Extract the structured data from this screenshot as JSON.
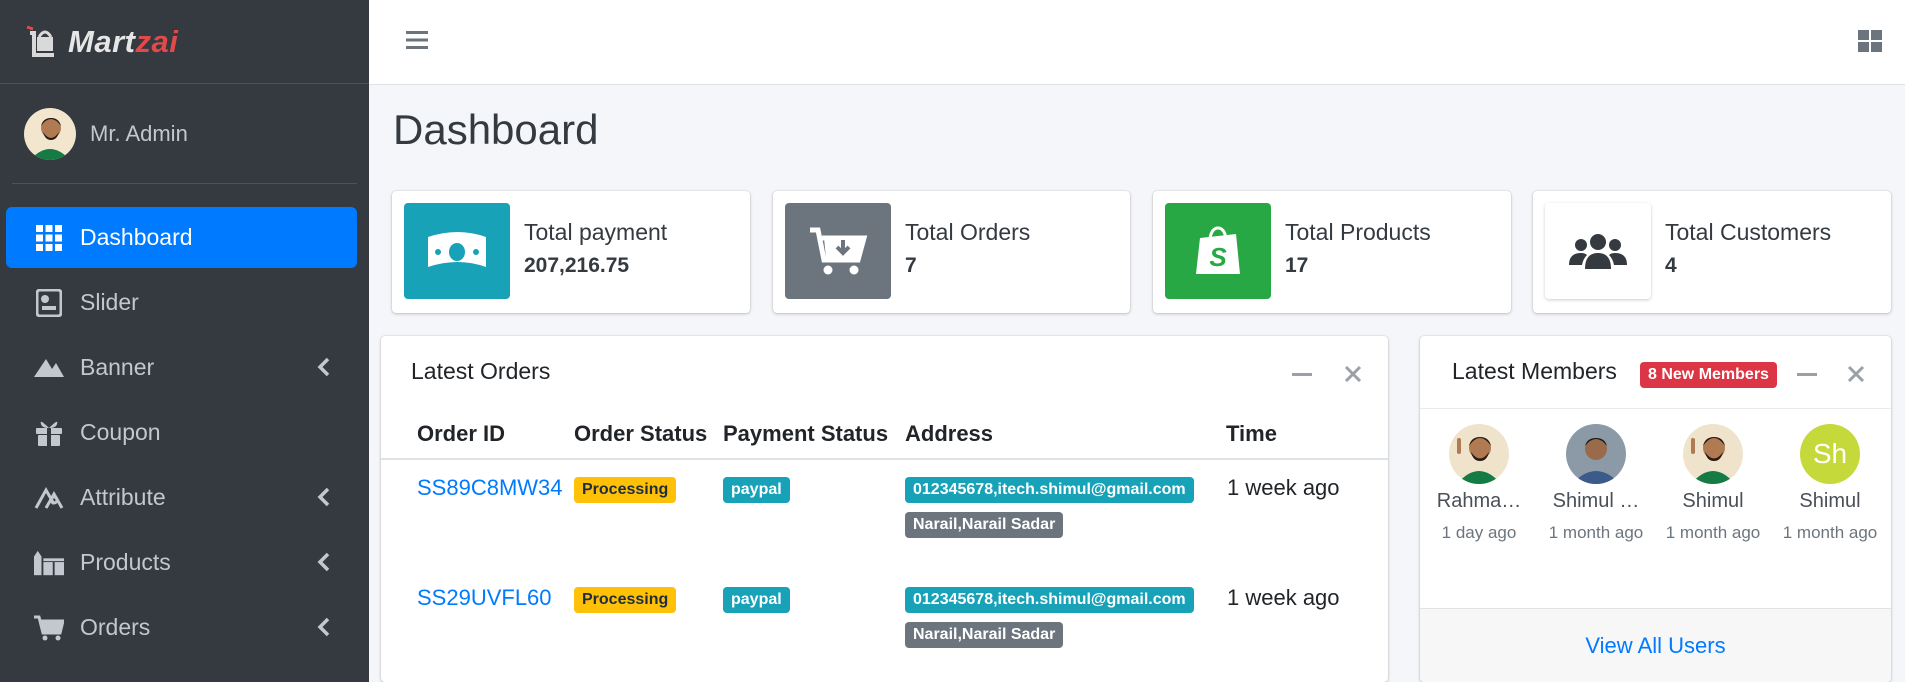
{
  "brand": {
    "name_main": "Mart",
    "name_accent": "zai"
  },
  "user": {
    "name": "Mr. Admin"
  },
  "sidebar": {
    "items": [
      {
        "label": "Dashboard",
        "icon": "th-grid-icon",
        "active": true
      },
      {
        "label": "Slider",
        "icon": "slider-icon"
      },
      {
        "label": "Banner",
        "icon": "banner-icon",
        "has_submenu": true
      },
      {
        "label": "Coupon",
        "icon": "gift-icon"
      },
      {
        "label": "Attribute",
        "icon": "attribute-icon",
        "has_submenu": true
      },
      {
        "label": "Products",
        "icon": "warehouse-icon",
        "has_submenu": true
      },
      {
        "label": "Orders",
        "icon": "cart-icon",
        "has_submenu": true
      }
    ]
  },
  "page": {
    "title": "Dashboard"
  },
  "info_boxes": [
    {
      "label": "Total payment",
      "value": "207,216.75",
      "color": "#17a2b8",
      "icon": "money-bill-icon"
    },
    {
      "label": "Total Orders",
      "value": "7",
      "color": "#6c757d",
      "icon": "cart-download-icon"
    },
    {
      "label": "Total Products",
      "value": "17",
      "color": "#28a745",
      "icon": "shopify-bag-icon"
    },
    {
      "label": "Total Customers",
      "value": "4",
      "color": "#ffffff",
      "icon": "users-icon"
    }
  ],
  "latest_orders": {
    "title": "Latest Orders",
    "columns": [
      "Order ID",
      "Order Status",
      "Payment Status",
      "Address",
      "Time"
    ],
    "rows": [
      {
        "order_id": "SS89C8MW34",
        "status": "Processing",
        "payment": "paypal",
        "address_contact": "012345678,itech.shimul@gmail.com",
        "address_place": "Narail,Narail Sadar",
        "time": "1 week ago"
      },
      {
        "order_id": "SS29UVFL60",
        "status": "Processing",
        "payment": "paypal",
        "address_contact": "012345678,itech.shimul@gmail.com",
        "address_place": "Narail,Narail Sadar",
        "time": "1 week ago"
      }
    ]
  },
  "latest_members": {
    "title": "Latest Members",
    "badge": "8 New Members",
    "members": [
      {
        "name": "Rahma…",
        "date": "1 day ago"
      },
      {
        "name": "Shimul …",
        "date": "1 month ago"
      },
      {
        "name": "Shimul",
        "date": "1 month ago"
      },
      {
        "name": "Shimul",
        "date": "1 month ago",
        "initials": "Sh"
      }
    ],
    "view_all": "View All Users"
  }
}
